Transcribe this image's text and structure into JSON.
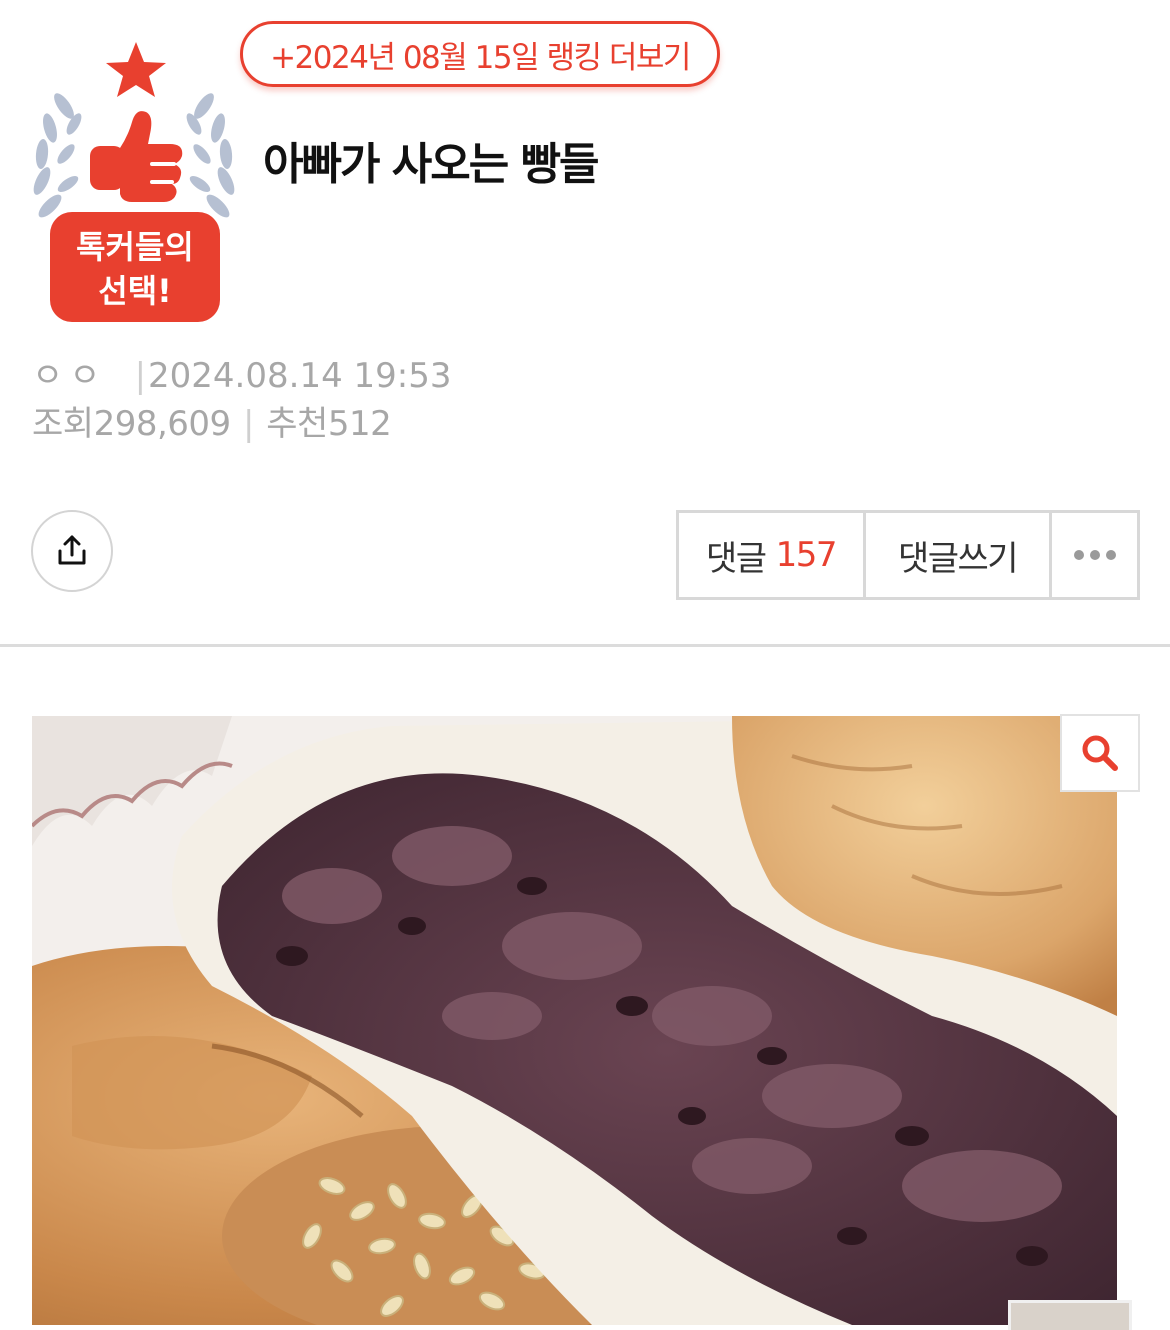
{
  "ranking_link": "+2024년 08월 15일 랭킹 더보기",
  "badge": {
    "line1": "톡커들의",
    "line2": "선택!",
    "icon": "thumbs-up-icon"
  },
  "post": {
    "title": "아빠가 사오는 빵들",
    "author": "ㅇㅇ",
    "date": "2024.08.14 19:53",
    "views_label": "조회",
    "views": "298,609",
    "recommend_label": "추천",
    "recommend": "512"
  },
  "actions": {
    "comments_label": "댓글",
    "comments_count": "157",
    "write_comment": "댓글쓰기",
    "share_icon": "share-icon",
    "more_icon": "more-dots-icon"
  },
  "colors": {
    "accent": "#e8402f",
    "meta_text": "#a7a7a7",
    "border": "#d8d8d8"
  },
  "image": {
    "subject": "red-bean-bun-photo",
    "zoom_icon": "search-icon"
  }
}
